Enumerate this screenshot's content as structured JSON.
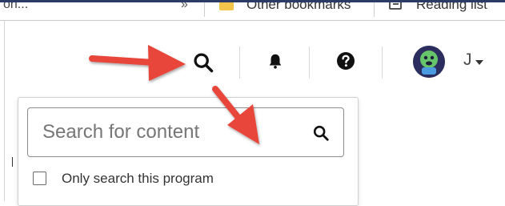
{
  "browser": {
    "bookmarks_cutoff": "on...",
    "overflow_chevron": "»",
    "other_bookmarks": "Other bookmarks",
    "reading_list": "Reading list"
  },
  "header": {
    "user_initial": "J",
    "icons": [
      "search-icon",
      "notification-bell-icon",
      "help-icon",
      "avatar",
      "caret-down-icon"
    ]
  },
  "search_panel": {
    "placeholder": "Search for content",
    "value": "",
    "only_search_program_label": "Only search this program",
    "only_search_program_checked": false
  },
  "annotations": {
    "arrow_color": "#e8443a",
    "count": 2
  },
  "colors": {
    "top_border": "#2b3a67",
    "avatar_bg": "#2b2d5e",
    "folder": "#f3c64b"
  }
}
